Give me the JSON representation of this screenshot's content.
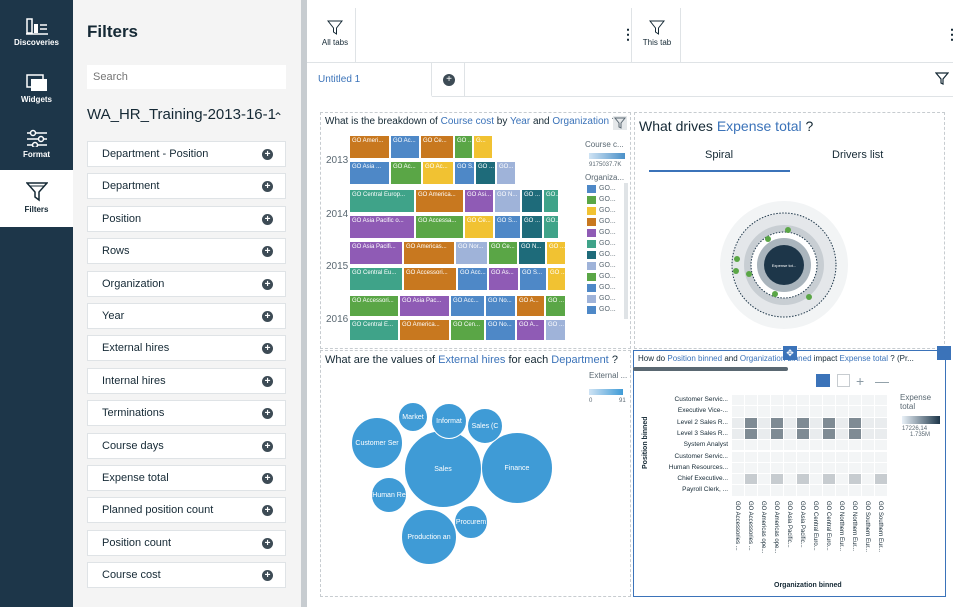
{
  "rail": {
    "items": [
      {
        "label": "Discoveries",
        "icon": "discoveries-icon"
      },
      {
        "label": "Widgets",
        "icon": "widgets-icon"
      },
      {
        "label": "Format",
        "icon": "format-icon"
      },
      {
        "label": "Filters",
        "icon": "filter-icon"
      }
    ]
  },
  "panel": {
    "title": "Filters",
    "search_placeholder": "Search",
    "dataset": "WA_HR_Training-2013-16-1",
    "fields": [
      "Department - Position",
      "Department",
      "Position",
      "Rows",
      "Organization",
      "Year",
      "External hires",
      "Internal hires",
      "Terminations",
      "Course days",
      "Expense total",
      "Planned position count",
      "Position count",
      "Course cost"
    ]
  },
  "toolbar": {
    "all_tabs": "All tabs",
    "this_tab": "This tab"
  },
  "tabs": {
    "tab1": "Untitled 1"
  },
  "viz1": {
    "title_pre": "What is the breakdown of",
    "m1": "Course cost",
    "by": "by",
    "m2": "Year",
    "and": "and",
    "m3": "Organization",
    "q": "?",
    "years": [
      "2013",
      "2014",
      "2015",
      "2016"
    ],
    "legend_title1": "Course c...",
    "legend_range": "9175037.7K",
    "legend_title2": "Organiza...",
    "legend_item": "GO...",
    "tiles": [
      [
        "GO Ameri...",
        "GO Ac...",
        "GO Ce...",
        "GO ...",
        "G..."
      ],
      [
        "GO Asia ...",
        "GO Ac...",
        "GO Ac...",
        "GO S...",
        "GO ...",
        "GO..."
      ],
      [
        "GO Central Europ...",
        "GO America...",
        "GO Asi...",
        "GO N...",
        "GO ...",
        "GO..."
      ],
      [
        "GO Asia Pacific o...",
        "GO Accessa...",
        "GO Ce...",
        "GO S...",
        "GO ...",
        "GO..."
      ],
      [
        "GO Asia Pacifi...",
        "GO Americas...",
        "GO Nor...",
        "GO Ce...",
        "GO N...",
        "GO ..."
      ],
      [
        "GO Central Eu...",
        "GO Accessori...",
        "GO Acc...",
        "GO As...",
        "GO S...",
        "GO ..."
      ],
      [
        "GO Accessori...",
        "GO Asia Pac...",
        "GO Acc...",
        "GO No...",
        "GO A...",
        "GO ..."
      ],
      [
        "GO Central E...",
        "GO America...",
        "GO Cen...",
        "GO No...",
        "GO A...",
        "GO ..."
      ]
    ]
  },
  "viz2": {
    "title_pre": "What drives",
    "metric": "Expense total",
    "q": "?",
    "tab_spiral": "Spiral",
    "tab_drivers": "Drivers list",
    "center_label": "Expense tot..."
  },
  "viz3": {
    "title_pre": "What are the values of",
    "m1": "External hires",
    "mid": "for each",
    "m2": "Department",
    "q": "?",
    "legend_title": "External ...",
    "legend_min": "0",
    "legend_max": "91",
    "bubbles": [
      "Sales",
      "Finance",
      "Customer Ser",
      "Production an",
      "Informat",
      "Sales (C",
      "Market",
      "Human Re",
      "Procurem"
    ]
  },
  "viz4": {
    "title_pre": "How do",
    "m1": "Position binned",
    "and": "and",
    "m2": "Organization binned",
    "mid": "impact",
    "m3": "Expense total",
    "tail": "? (Pr...",
    "ylabel": "Position binned",
    "xlabel": "Organization binned",
    "legend_title": "Expense total",
    "legend_v1": "17226,14",
    "legend_v2": "1.735M",
    "rows": [
      "Customer Servic...",
      "Executive Vice-...",
      "Level 2 Sales R...",
      "Level 3 Sales R...",
      "System Analyst",
      "Customer Servic...",
      "Human Resources...",
      "Chief Executive...",
      "Payroll Clerk, ..."
    ],
    "cols": [
      "GO Accessories ...",
      "GO Accessories ...",
      "GO Americas ope...",
      "GO Americas ope...",
      "GO Asia Pacific...",
      "GO Asia Pacific...",
      "GO Central Euro...",
      "GO Central Euro...",
      "GO Northern Eur...",
      "GO Northern Eur...",
      "GO Southern Eur...",
      "GO Southern Eur..."
    ]
  },
  "colors": {
    "rail": "#1d3649",
    "accent": "#3b73b9",
    "bubble": "#3f9bd6"
  }
}
